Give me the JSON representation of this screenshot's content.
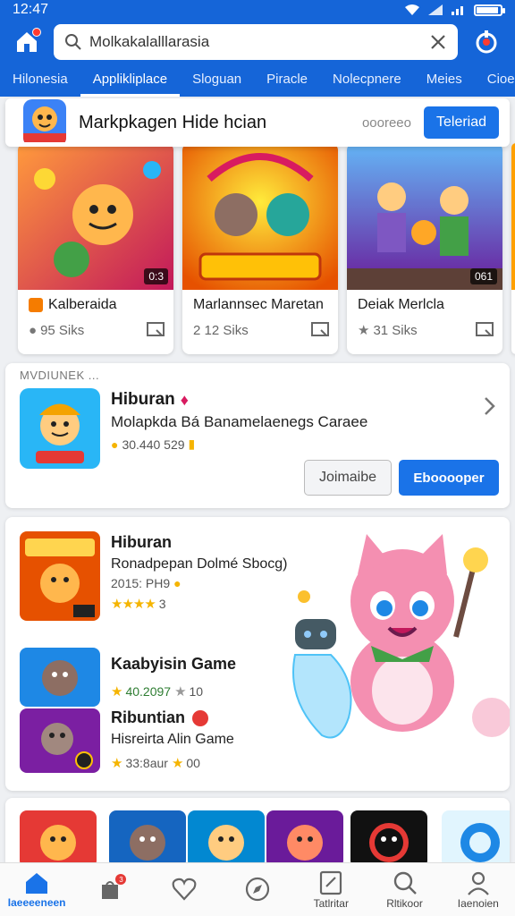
{
  "status_bar": {
    "time": "12:47"
  },
  "header": {
    "search_value": "Molkakalalllarasia",
    "search_placeholder": "Molkakalalllarasia"
  },
  "tabs": [
    {
      "label": "Hilonesia"
    },
    {
      "label": "Applikliplace"
    },
    {
      "label": "Sloguan"
    },
    {
      "label": "Piracle"
    },
    {
      "label": "Nolecpnere"
    },
    {
      "label": "Meies"
    },
    {
      "label": "Cioer"
    }
  ],
  "banner": {
    "title": "Markpkagen  Hide  hcian",
    "meta": "oooreeo",
    "button": "Teleriad"
  },
  "cards": [
    {
      "name": "Kalberaida",
      "corner": "0:3",
      "stat": "95 Siks"
    },
    {
      "name": "Marlannsec Maretan",
      "corner": "",
      "stat": "2 12 Siks"
    },
    {
      "name": "Deiak Merlcla",
      "corner": "061",
      "stat": "31 Siks"
    }
  ],
  "featured": {
    "section_label": "MVDIUNEK ...",
    "title": "Hiburan",
    "subtitle": "Molapkda Bá Banamelaenegs Caraee",
    "count": "30.440 529",
    "outline_button": "Joimaibe",
    "primary_button": "Ebooooper"
  },
  "list": [
    {
      "title": "Hiburan",
      "subtitle": "Ronadpepan Dolmé Sbocg)",
      "meta": "2015: PH9",
      "rating": "3",
      "stars": "★★★★"
    },
    {
      "title": "Kaabyisin Game",
      "subtitle": "",
      "meta": "40.2097",
      "rating": "10",
      "stars": "★"
    },
    {
      "title": "Ribuntian",
      "subtitle": "Hisreirta Alin Game",
      "meta": "33:8aur",
      "rating": "00",
      "stars": "★"
    }
  ],
  "bottom_nav": [
    {
      "label": "Iaeeeeneen",
      "icon": "home-icon"
    },
    {
      "label": "",
      "icon": "bag-icon"
    },
    {
      "label": "",
      "icon": "heart-icon"
    },
    {
      "label": "",
      "icon": "compass-icon"
    },
    {
      "label": "Tatlritar",
      "icon": "edit-icon"
    },
    {
      "label": "Rltikoor",
      "icon": "search-icon"
    },
    {
      "label": "Iaenoien",
      "icon": "person-icon"
    }
  ],
  "colors": {
    "primary": "#1565d8",
    "accent": "#1a73e8",
    "star": "#f5b400"
  }
}
